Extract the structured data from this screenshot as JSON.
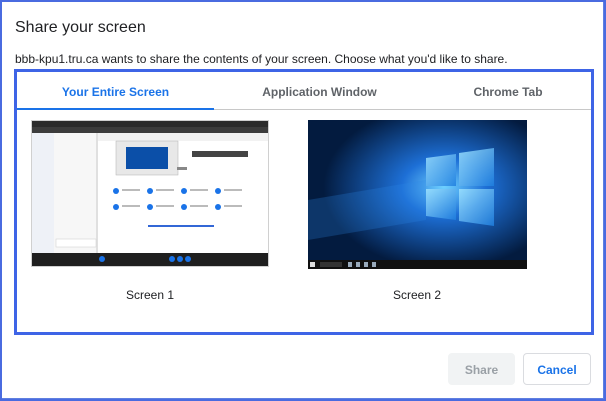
{
  "dialog": {
    "title": "Share your screen",
    "subtitle": "bbb-kpu1.tru.ca wants to share the contents of your screen. Choose what you'd like to share."
  },
  "tabs": [
    {
      "label": "Your Entire Screen",
      "active": true
    },
    {
      "label": "Application Window",
      "active": false
    },
    {
      "label": "Chrome Tab",
      "active": false
    }
  ],
  "screens": [
    {
      "label": "Screen 1"
    },
    {
      "label": "Screen 2"
    }
  ],
  "buttons": {
    "share_label": "Share",
    "cancel_label": "Cancel"
  },
  "colors": {
    "accent": "#1a73e8",
    "highlight_border": "#3e64e6",
    "disabled_button_bg": "#f1f3f4",
    "desktop_bg": "#031b3f"
  }
}
